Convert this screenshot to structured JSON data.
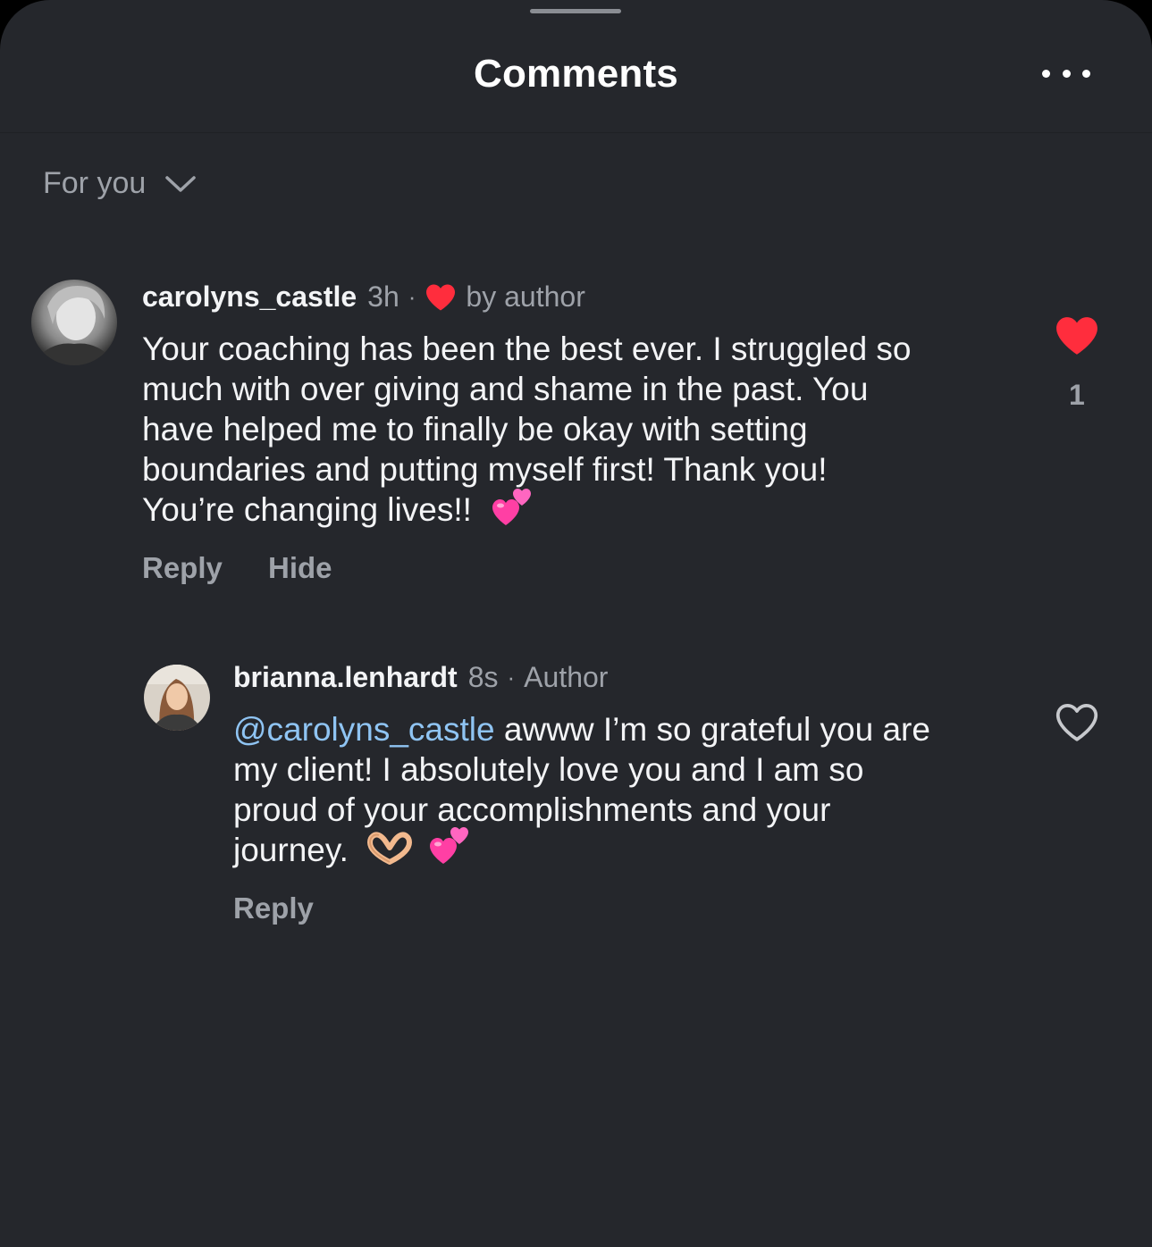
{
  "header": {
    "title": "Comments",
    "more_icon": "more-horizontal-icon"
  },
  "sort": {
    "selected": "For you",
    "icon": "chevron-down-icon"
  },
  "colors": {
    "background": "#25272c",
    "heart_red": "#ff2d3d",
    "mention_blue": "#8fc4f3",
    "muted_text": "#9ea2a9"
  },
  "comments": [
    {
      "username": "carolyns_castle",
      "time": "3h",
      "separator": "·",
      "liked_by_author_label": "by author",
      "text_lines": [
        "Your coaching has been the best ever. I struggled so",
        "much with over giving and shame in the past. You",
        "have helped me to finally be okay with setting",
        "boundaries and putting myself first! Thank you!",
        "You’re changing lives!!"
      ],
      "emoji": "two-hearts-icon",
      "actions": [
        "Reply",
        "Hide"
      ],
      "liked": true,
      "like_count": "1"
    },
    {
      "username": "brianna.lenhardt",
      "time": "8s",
      "separator": "·",
      "role": "Author",
      "mention": "@carolyns_castle",
      "text_first": " awww I’m so grateful you are",
      "text_lines": [
        "my client! I absolutely love you and I am so",
        "proud of your accomplishments and your",
        "journey."
      ],
      "emojis": [
        "heart-hands-icon",
        "two-hearts-icon"
      ],
      "actions": [
        "Reply"
      ],
      "liked": false
    }
  ]
}
